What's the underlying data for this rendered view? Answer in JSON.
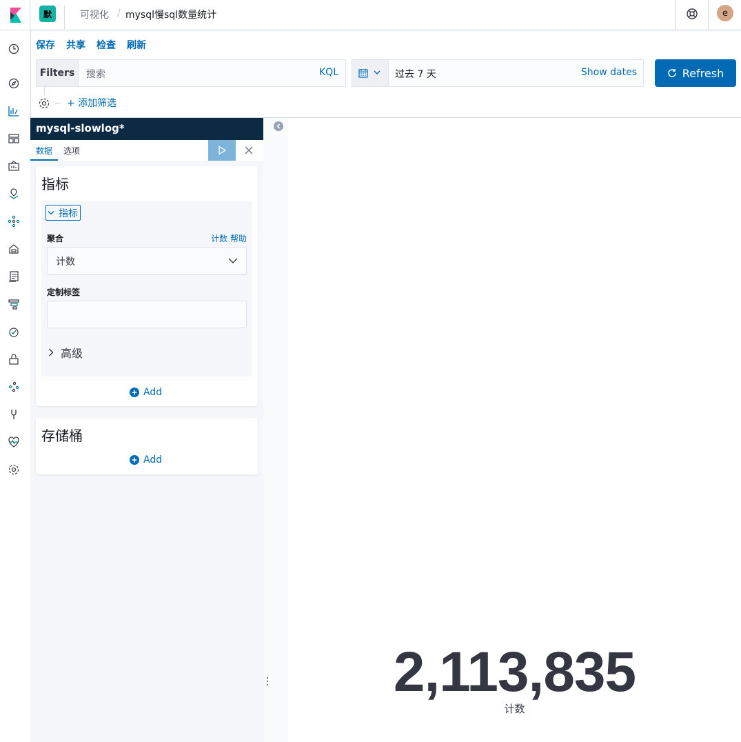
{
  "header": {
    "space_initial": "默",
    "breadcrumb_parent": "可视化",
    "breadcrumb_separator": "/",
    "breadcrumb_current": "mysql慢sql数量统计",
    "avatar_initial": "e"
  },
  "top_menu": {
    "save": "保存",
    "share": "共享",
    "inspect": "检查",
    "refresh": "刷新"
  },
  "query_bar": {
    "filters_label": "Filters",
    "search_placeholder": "搜索",
    "language": "KQL",
    "date_range": "过去 7 天",
    "show_dates": "Show dates",
    "refresh_button": "Refresh",
    "add_filter": "+ 添加筛选"
  },
  "editor": {
    "index_pattern": "mysql-slowlog*",
    "tabs": [
      "数据",
      "选项"
    ],
    "metrics_title": "指标",
    "metric_toggle": "指标",
    "agg_label": "聚合",
    "agg_help": "计数 帮助",
    "agg_value": "计数",
    "custom_label": "定制标签",
    "advanced": "高级",
    "add": "Add",
    "buckets_title": "存储桶",
    "buckets_add": "Add"
  },
  "metric": {
    "value": "2,113,835",
    "label": "计数"
  },
  "colors": {
    "primary": "#006bb4",
    "nav_dark": "#0c2a44",
    "space_badge": "#16b3a4"
  }
}
